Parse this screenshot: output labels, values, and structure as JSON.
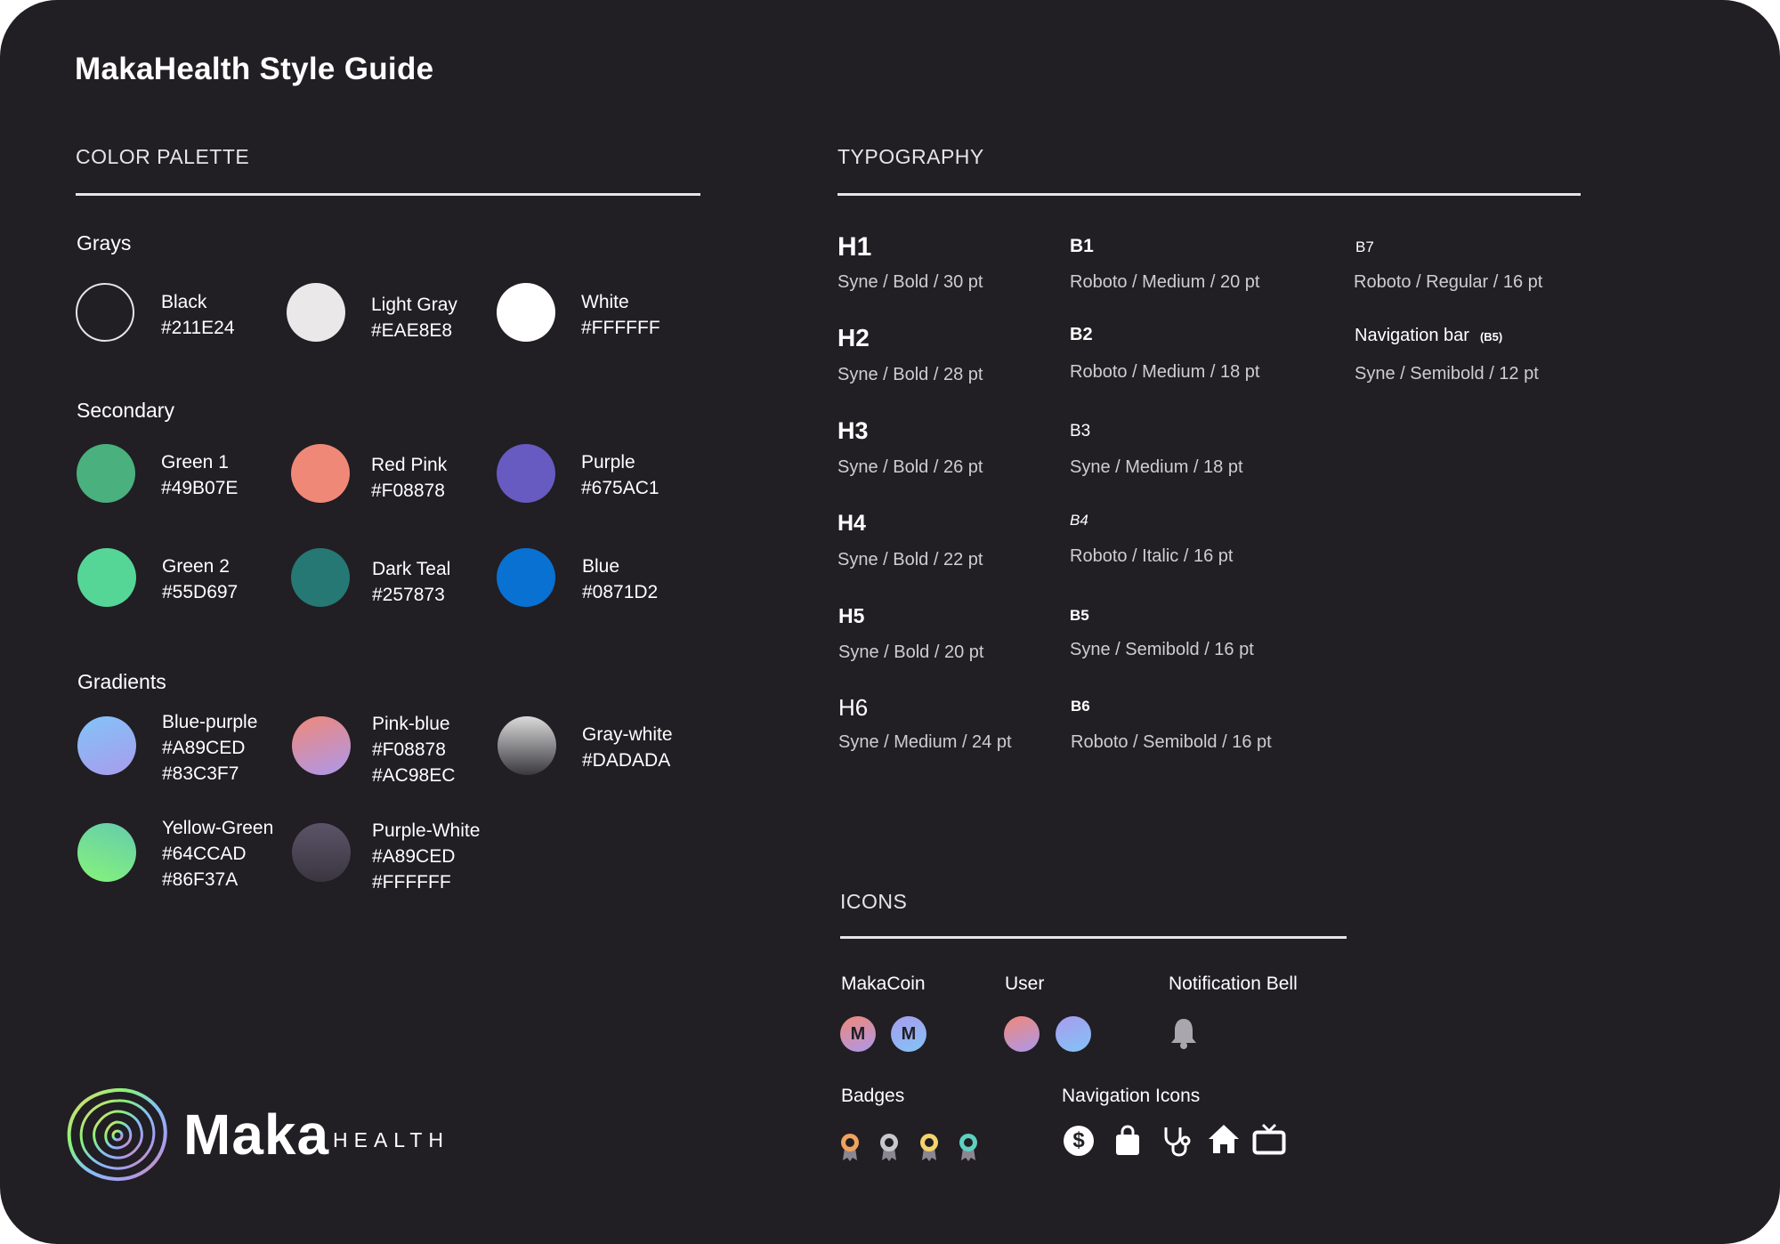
{
  "page": {
    "title": "MakaHealth Style Guide"
  },
  "color_palette": {
    "heading": "COLOR PALETTE",
    "groups": {
      "grays": {
        "label": "Grays",
        "items": [
          {
            "name": "Black",
            "hex": "#211E24",
            "fill": "#211E24"
          },
          {
            "name": "Light Gray",
            "hex": "#EAE8E8",
            "fill": "#EAE8E8"
          },
          {
            "name": "White",
            "hex": "#FFFFFF",
            "fill": "#FFFFFF"
          }
        ]
      },
      "secondary": {
        "label": "Secondary",
        "items": [
          {
            "name": "Green 1",
            "hex": "#49B07E",
            "fill": "#49B07E"
          },
          {
            "name": "Red Pink",
            "hex": "#F08878",
            "fill": "#F08878"
          },
          {
            "name": "Purple",
            "hex": "#675AC1",
            "fill": "#675AC1"
          },
          {
            "name": "Green 2",
            "hex": "#55D697",
            "fill": "#55D697"
          },
          {
            "name": "Dark Teal",
            "hex": "#257873",
            "fill": "#257873"
          },
          {
            "name": "Blue",
            "hex": "#0871D2",
            "fill": "#0871D2"
          }
        ]
      },
      "gradients": {
        "label": "Gradients",
        "items": [
          {
            "name": "Blue-purple",
            "hex1": "#A89CED",
            "hex2": "#83C3F7"
          },
          {
            "name": "Pink-blue",
            "hex1": "#F08878",
            "hex2": "#AC98EC"
          },
          {
            "name": "Gray-white",
            "hex1": "#DADADA"
          },
          {
            "name": "Yellow-Green",
            "hex1": "#64CCAD",
            "hex2": "#86F37A"
          },
          {
            "name": "Purple-White",
            "hex1": "#A89CED",
            "hex2": "#FFFFFF"
          }
        ]
      }
    }
  },
  "typography": {
    "heading": "TYPOGRAPHY",
    "headings": [
      {
        "label": "H1",
        "spec": "Syne / Bold / 30 pt"
      },
      {
        "label": "H2",
        "spec": "Syne / Bold / 28 pt"
      },
      {
        "label": "H3",
        "spec": "Syne / Bold / 26 pt"
      },
      {
        "label": "H4",
        "spec": "Syne / Bold / 22 pt"
      },
      {
        "label": "H5",
        "spec": "Syne / Bold / 20 pt"
      },
      {
        "label": "H6",
        "spec": "Syne / Medium / 24 pt"
      }
    ],
    "body": [
      {
        "label": "B1",
        "spec": "Roboto / Medium / 20 pt"
      },
      {
        "label": "B2",
        "spec": "Roboto / Medium / 18 pt"
      },
      {
        "label": "B3",
        "spec": "Syne / Medium / 18 pt"
      },
      {
        "label": "B4",
        "spec": "Roboto / Italic / 16 pt"
      },
      {
        "label": "B5",
        "spec": "Syne / Semibold / 16 pt"
      },
      {
        "label": "B6",
        "spec": "Roboto / Semibold / 16 pt"
      }
    ],
    "extra": [
      {
        "label": "B7",
        "spec": "Roboto / Regular / 16 pt"
      },
      {
        "label": "Navigation bar",
        "tag": "(B5)",
        "spec": "Syne / Semibold / 12 pt"
      }
    ]
  },
  "icons": {
    "heading": "ICONS",
    "makacoin": {
      "label": "MakaCoin",
      "glyph": "M"
    },
    "user": {
      "label": "User"
    },
    "bell": {
      "label": "Notification Bell"
    },
    "badges": {
      "label": "Badges"
    },
    "nav": {
      "label": "Navigation Icons",
      "dollar_glyph": "$"
    }
  },
  "logo": {
    "word": "Maka",
    "sub": "HEALTH"
  }
}
